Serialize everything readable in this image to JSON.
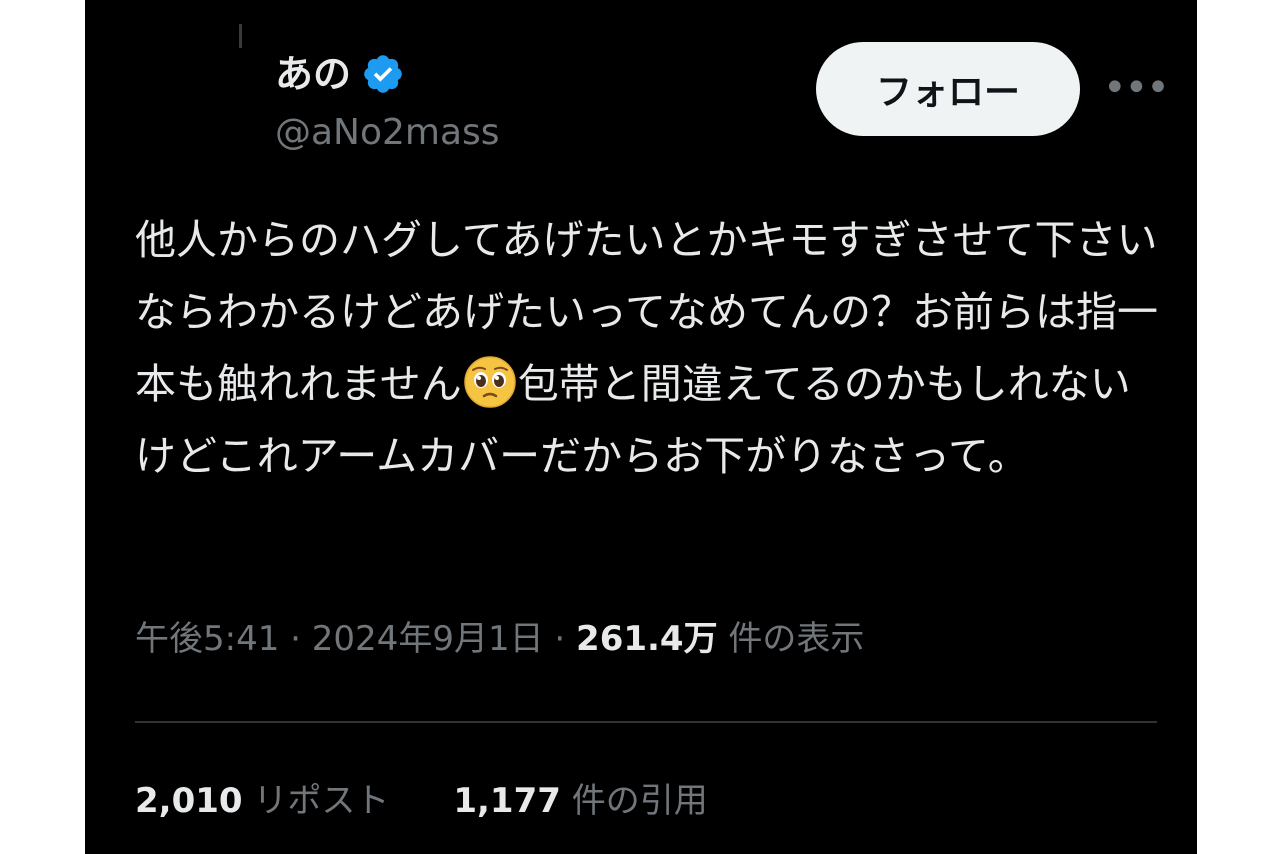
{
  "user": {
    "display_name": "あの",
    "handle": "@aNo2mass",
    "verified": true
  },
  "actions": {
    "follow_label": "フォロー",
    "more_label": "•••"
  },
  "tweet": {
    "text_before_emoji": "他人からのハグしてあげたいとかキモすぎさせて下さいならわかるけどあげたいってなめてんの？お前らは指一本も触れれません",
    "emoji_name": "pleading-face-emoji",
    "text_after_emoji": "包帯と間違えてるのかもしれないけどこれアームカバーだからお下がりなさって。"
  },
  "meta": {
    "time": "午後5:41",
    "sep1": " · ",
    "date": "2024年9月1日",
    "sep2": " · ",
    "views_count": "261.4万",
    "views_label": " 件の表示"
  },
  "stats": {
    "reposts_count": "2,010",
    "reposts_label": " リポスト",
    "quotes_count": "1,177",
    "quotes_label": " 件の引用"
  },
  "colors": {
    "background": "#000000",
    "text_primary": "#e7e9ea",
    "text_secondary": "#71767b",
    "verified_badge": "#1d9bf0",
    "follow_button_bg": "#eff3f4",
    "divider": "#2f3336"
  }
}
